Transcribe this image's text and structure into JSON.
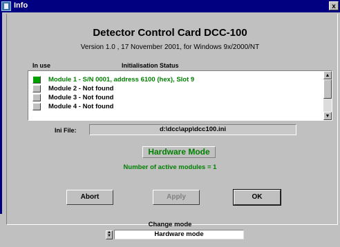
{
  "window": {
    "title": "Info",
    "close_glyph": "x",
    "icon": "app-icon"
  },
  "header": {
    "title": "Detector Control Card DCC-100",
    "subtitle": "Version 1.0 , 17 November 2001, for Windows 9x/2000/NT"
  },
  "list": {
    "col_in_use": "In use",
    "col_status": "Initialisation Status",
    "rows": [
      {
        "text": "Module 1 - S/N 0001, address 6100 (hex), Slot 9",
        "in_use": true,
        "color": "#008000"
      },
      {
        "text": "Module 2 -  Not found",
        "in_use": false,
        "color": "#000000"
      },
      {
        "text": "Module 3 -  Not found",
        "in_use": false,
        "color": "#000000"
      },
      {
        "text": "Module 4 -  Not found",
        "in_use": false,
        "color": "#000000"
      }
    ]
  },
  "ini": {
    "label": "Ini File:",
    "value": "d:\\dcc\\app\\dcc100.ini"
  },
  "status": {
    "mode": "Hardware Mode",
    "active_modules": "Number of active modules = 1",
    "color": "#008000"
  },
  "buttons": {
    "abort": "Abort",
    "apply": "Apply",
    "ok": "OK"
  },
  "change_mode": {
    "label": "Change mode",
    "selected": "Hardware mode"
  },
  "colors": {
    "led_on": "#00a000",
    "led_off": "#c0c0c0",
    "disabled_text": "#808080"
  }
}
